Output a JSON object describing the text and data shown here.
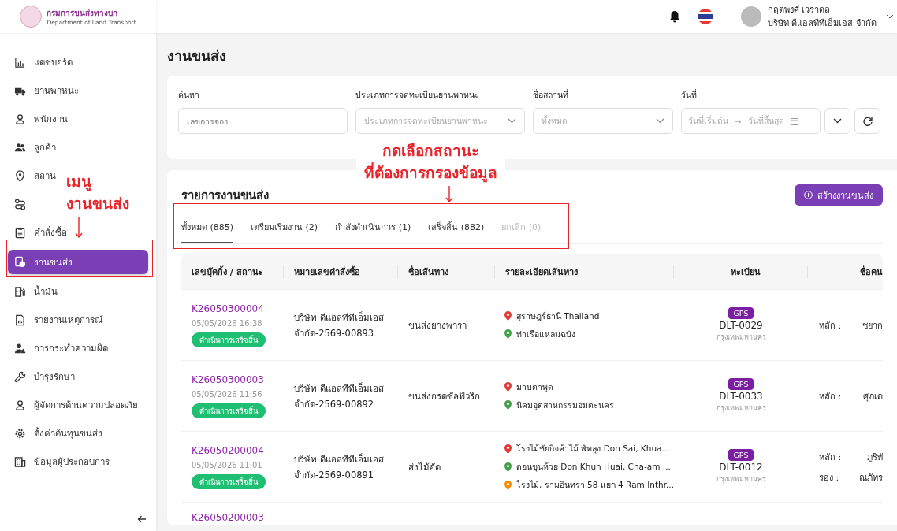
{
  "header": {
    "logo_title": "กรมการขนส่งทางบก",
    "logo_subtitle": "Department of Land Transport",
    "user_name": "กฤตพงศ์ เวราดล",
    "user_company": "บริษัท ดีแอลทีทีเอ็มเอส จำกัด"
  },
  "sidebar": {
    "items": [
      {
        "label": "แดชบอร์ด",
        "selected": false
      },
      {
        "label": "ยานพาหนะ",
        "selected": false
      },
      {
        "label": "พนักงาน",
        "selected": false
      },
      {
        "label": "ลูกค้า",
        "selected": false
      },
      {
        "label": "สถาน",
        "selected": false
      },
      {
        "selected": false
      },
      {
        "label": "คำสั่งซื้อ",
        "selected": false
      },
      {
        "label": "งานขนส่ง",
        "selected": true
      },
      {
        "label": "น้ำมัน",
        "selected": false
      },
      {
        "label": "รายงานเหตุการณ์",
        "selected": false
      },
      {
        "label": "การกระทำความผิด",
        "selected": false
      },
      {
        "label": "บำรุงรักษา",
        "selected": false
      },
      {
        "label": "ผู้จัดการด้านความปลอดภัย",
        "selected": false
      },
      {
        "label": "ตั้งค่าต้นทุนขนส่ง",
        "selected": false
      },
      {
        "label": "ข้อมูลผู้ประกอบการ",
        "selected": false
      }
    ]
  },
  "page_title": "งานขนส่ง",
  "filters": [
    {
      "kind": "text",
      "label": "ค้นหา",
      "placeholder": "เลขการจอง"
    },
    {
      "kind": "select",
      "label": "ประเภทการจดทะเบียนยานพาหนะ",
      "placeholder": "ประเภทการจดทะเบียนยานพาหนะ"
    },
    {
      "kind": "select",
      "label": "ชื่อสถานที่",
      "placeholder": "ทั้งหมด"
    },
    {
      "kind": "daterange",
      "label": "วันที่",
      "start_placeholder": "วันที่เริ่มต้น",
      "separator": "→",
      "end_placeholder": "วันที่สิ้นสุด"
    }
  ],
  "list": {
    "title": "รายการงานขนส่ง",
    "create_button": "สร้างงานขนส่ง",
    "tabs": [
      {
        "label": "ทั้งหมด (885)",
        "selected": true,
        "disabled": false
      },
      {
        "label": "เตรียมเริ่มงาน (2)",
        "selected": false,
        "disabled": false
      },
      {
        "label": "กำลังดำเนินการ (1)",
        "selected": false,
        "disabled": false
      },
      {
        "label": "เสร็จสิ้น (882)",
        "selected": false,
        "disabled": false
      },
      {
        "label": "ยกเลิก (0)",
        "selected": false,
        "disabled": true
      }
    ],
    "columns": [
      "เลขบุ๊คกิ้ง / สถานะ",
      "หมายเลขคำสั่งซื้อ",
      "ชื่อเส้นทาง",
      "รายละเอียดเส้นทาง",
      "ทะเบียน",
      "ชื่อคน"
    ],
    "rows": [
      {
        "code": "K26050300004",
        "datetime": "05/05/2026 16:38",
        "status": "ดำเนินการเสร็จสิ้น",
        "order_lines": [
          "บริษัท ดีแอลทีทีเอ็มเอส",
          "จำกัด-2569-00893"
        ],
        "route": "ขนส่งยางพารา",
        "stops": [
          {
            "text": "สุราษฎร์ธานี Thailand",
            "color": "#e53935"
          },
          {
            "text": "ท่าเรือแหลมฉบัง",
            "color": "#43a047"
          }
        ],
        "gps": "GPS",
        "plate": "DLT-0029",
        "province": "กรุงเทพมหานคร",
        "drivers": [
          {
            "role": "หลัก :",
            "name": "ชยาก"
          }
        ]
      },
      {
        "code": "K26050300003",
        "datetime": "05/05/2026 11:56",
        "status": "ดำเนินการเสร็จสิ้น",
        "order_lines": [
          "บริษัท ดีแอลทีทีเอ็มเอส",
          "จำกัด-2569-00892"
        ],
        "route": "ขนส่งกรดซัลฟิวริก",
        "stops": [
          {
            "text": "มาบตาพุด",
            "color": "#e53935"
          },
          {
            "text": "นิคมอุตสาหกรรมอมตะนคร",
            "color": "#43a047"
          }
        ],
        "gps": "GPS",
        "plate": "DLT-0033",
        "province": "กรุงเทพมหานคร",
        "drivers": [
          {
            "role": "หลัก :",
            "name": "ศุภเด"
          }
        ]
      },
      {
        "code": "K26050200004",
        "datetime": "05/05/2026 11:01",
        "status": "ดำเนินการเสร็จสิ้น",
        "order_lines": [
          "บริษัท ดีแอลทีทีเอ็มเอส",
          "จำกัด-2569-00891"
        ],
        "route": "ส่งไม้อัด",
        "stops": [
          {
            "text": "โรงไม้ชัยกิจค้าไม้ พัทลุง Don Sai, Khua...",
            "color": "#e53935"
          },
          {
            "text": "ดอนขุนห้วย Don Khun Huai, Cha-am ...",
            "color": "#43a047"
          },
          {
            "text": "โรงไม้, รามอินทรา 58 แยก 4 Ram Inthr...",
            "color": "#fb8c00"
          }
        ],
        "gps": "GPS",
        "plate": "DLT-0012",
        "province": "กรุงเทพมหานคร",
        "drivers": [
          {
            "role": "หลัก :",
            "name": "ภูริทั"
          },
          {
            "role": "รอง :",
            "name": "ณภัทร"
          }
        ]
      },
      {
        "code": "K26050200003"
      }
    ]
  },
  "annotations": [
    {
      "kind": "menu",
      "lines": [
        "เมนู",
        "งานขนส่ง"
      ]
    },
    {
      "kind": "tabs",
      "lines": [
        "กดเลือกสถานะ",
        "ที่ต้องการกรองข้อมูล"
      ]
    }
  ]
}
